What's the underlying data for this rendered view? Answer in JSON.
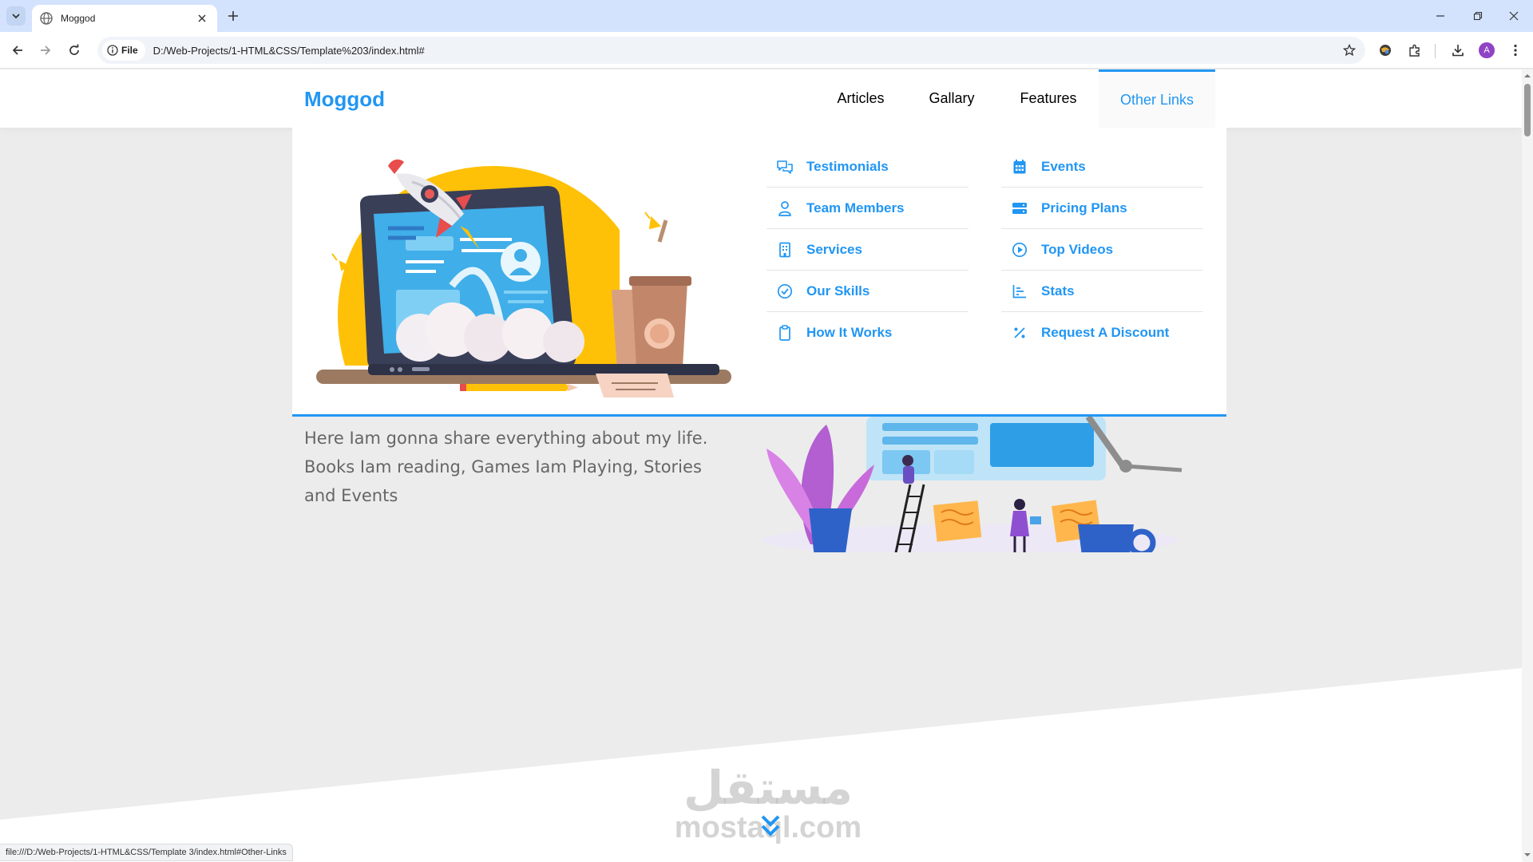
{
  "browser": {
    "tab_title": "Moggod",
    "site_chip": "File",
    "url": "D:/Web-Projects/1-HTML&CSS/Template%203/index.html#",
    "profile_initial": "A",
    "status_url": "file:///D:/Web-Projects/1-HTML&CSS/Template 3/index.html#Other-Links"
  },
  "site": {
    "logo": "Moggod",
    "nav": [
      {
        "label": "Articles"
      },
      {
        "label": "Gallary"
      },
      {
        "label": "Features"
      },
      {
        "label": "Other Links",
        "active": true
      }
    ]
  },
  "mega_menu": {
    "column_1": [
      {
        "label": "Testimonials",
        "icon": "comments-icon"
      },
      {
        "label": "Team Members",
        "icon": "user-icon"
      },
      {
        "label": "Services",
        "icon": "building-icon"
      },
      {
        "label": "Our Skills",
        "icon": "check-circle-icon"
      },
      {
        "label": "How It Works",
        "icon": "clipboard-icon"
      }
    ],
    "column_2": [
      {
        "label": "Events",
        "icon": "calendar-icon"
      },
      {
        "label": "Pricing Plans",
        "icon": "server-icon"
      },
      {
        "label": "Top Videos",
        "icon": "play-circle-icon"
      },
      {
        "label": "Stats",
        "icon": "chart-bars-icon"
      },
      {
        "label": "Request A Discount",
        "icon": "percent-icon"
      }
    ]
  },
  "hero": {
    "text": "Here Iam gonna share everything about my life. Books Iam reading, Games Iam Playing, Stories and Events"
  },
  "watermark": {
    "arabic": "مستقل",
    "latin": "mostaql.com"
  },
  "colors": {
    "accent": "#2196f3",
    "page_bg": "#ececec",
    "tabbar_bg": "#d3e3fd"
  }
}
